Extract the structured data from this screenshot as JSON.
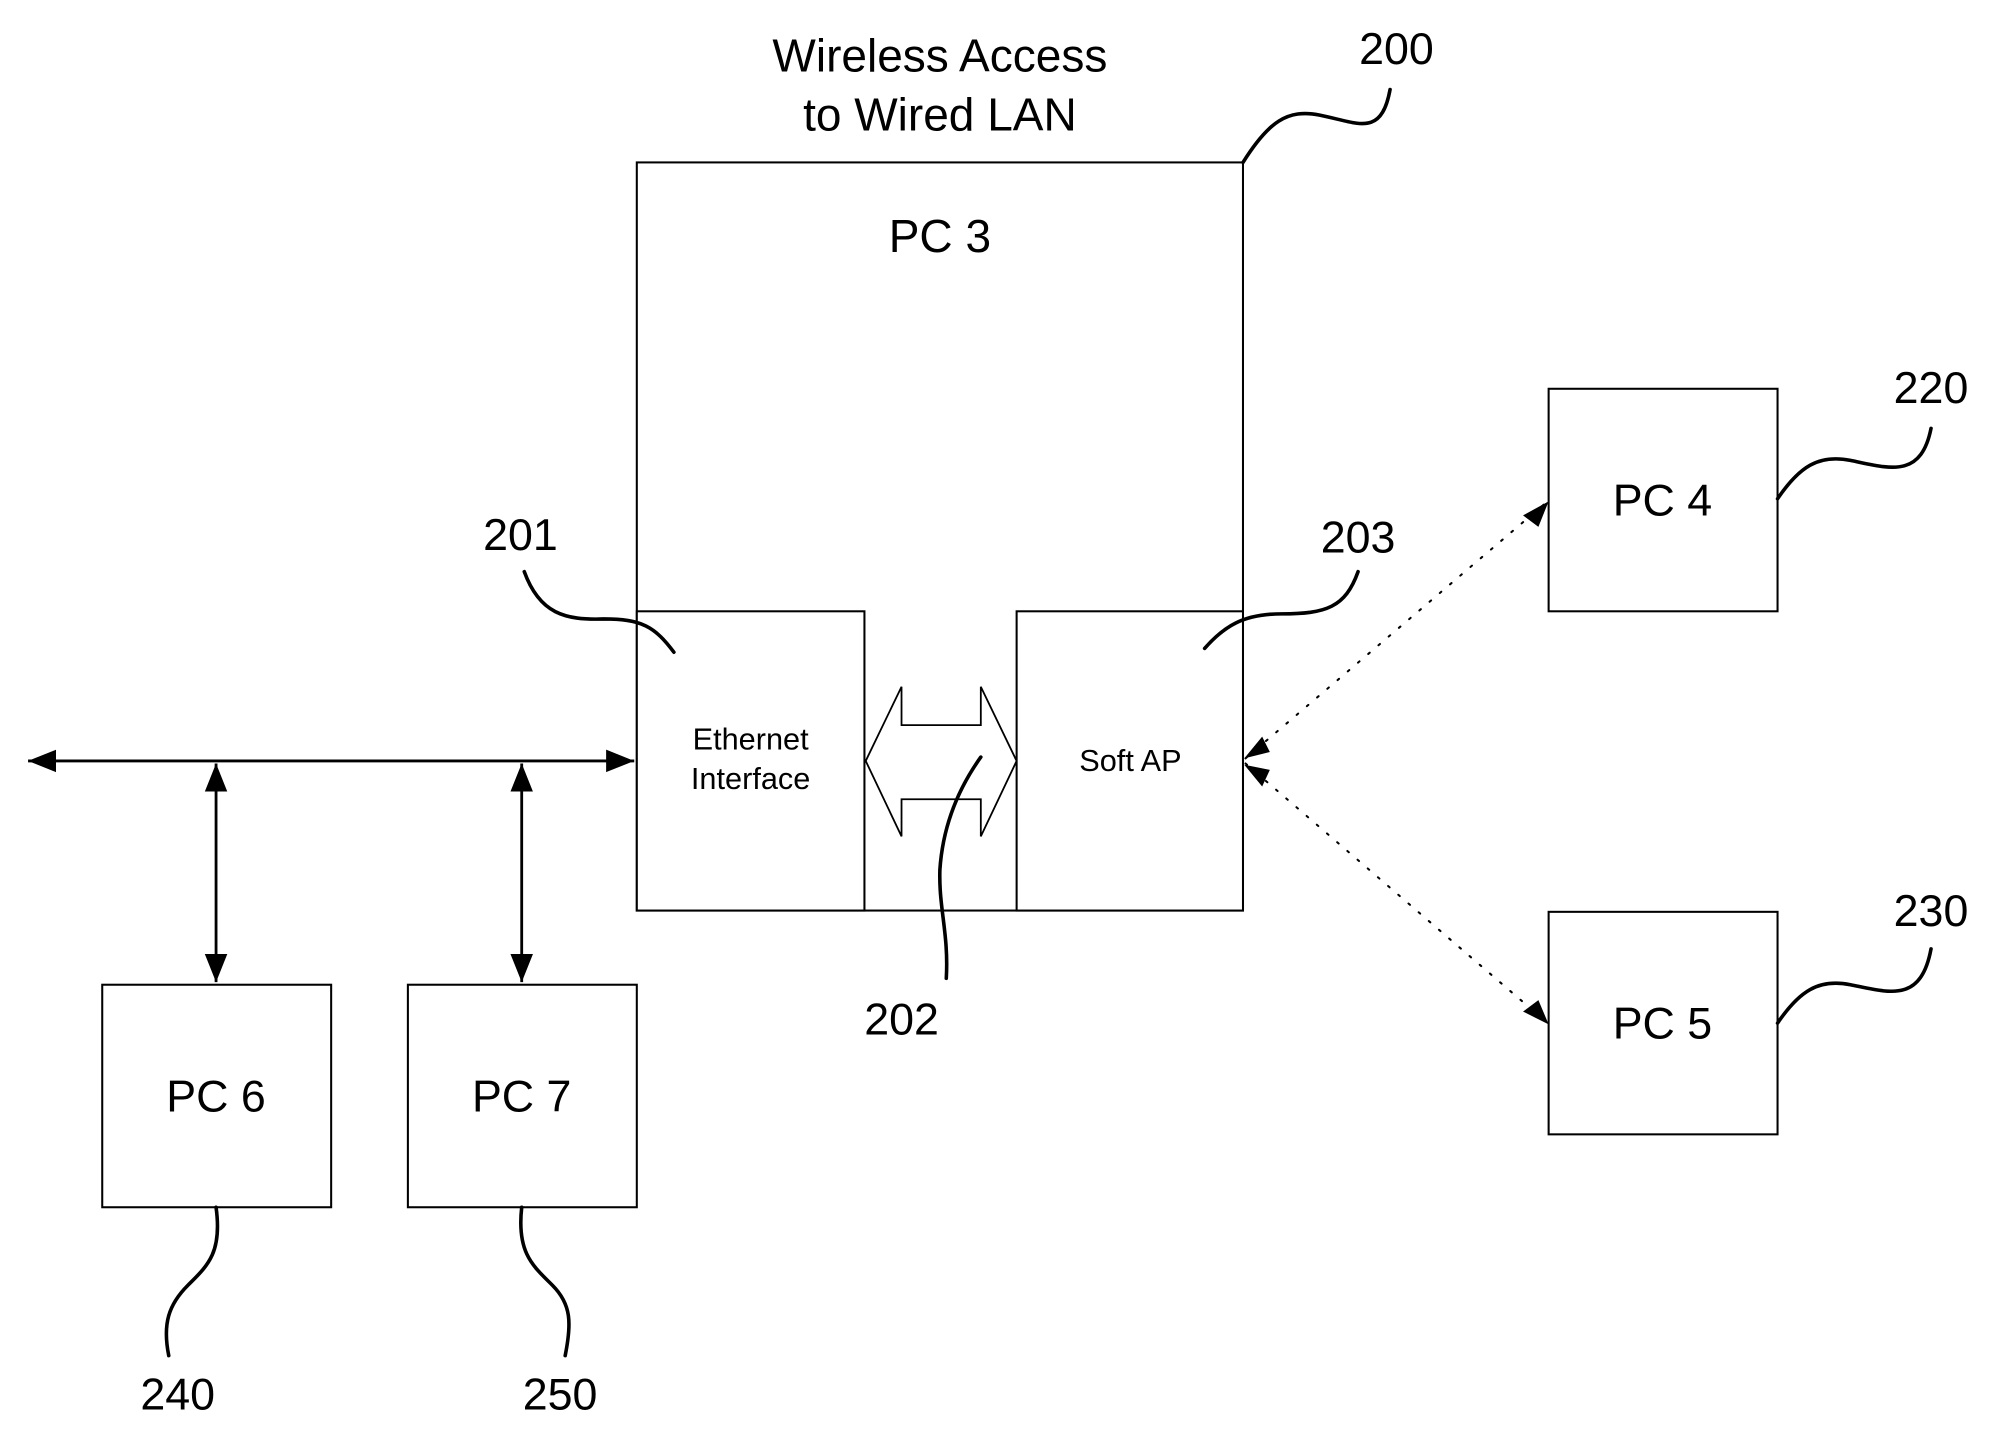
{
  "title": {
    "line1": "Wireless Access",
    "line2": "to Wired LAN"
  },
  "nodes": {
    "pc3": "PC 3",
    "ethernet_line1": "Ethernet",
    "ethernet_line2": "Interface",
    "soft_ap": "Soft AP",
    "pc4": "PC 4",
    "pc5": "PC 5",
    "pc6": "PC 6",
    "pc7": "PC 7"
  },
  "reference_numerals": {
    "pc3_system": "200",
    "ethernet_interface": "201",
    "internal_link": "202",
    "soft_ap": "203",
    "pc4": "220",
    "pc5": "230",
    "pc6": "240",
    "pc7": "250"
  },
  "connections": [
    {
      "from": "wired-bus",
      "to": "Ethernet Interface",
      "type": "wired"
    },
    {
      "from": "wired-bus",
      "to": "PC 6",
      "type": "wired"
    },
    {
      "from": "wired-bus",
      "to": "PC 7",
      "type": "wired"
    },
    {
      "from": "Ethernet Interface",
      "to": "Soft AP",
      "type": "internal-bidirectional"
    },
    {
      "from": "Soft AP",
      "to": "PC 4",
      "type": "wireless"
    },
    {
      "from": "Soft AP",
      "to": "PC 5",
      "type": "wireless"
    }
  ]
}
